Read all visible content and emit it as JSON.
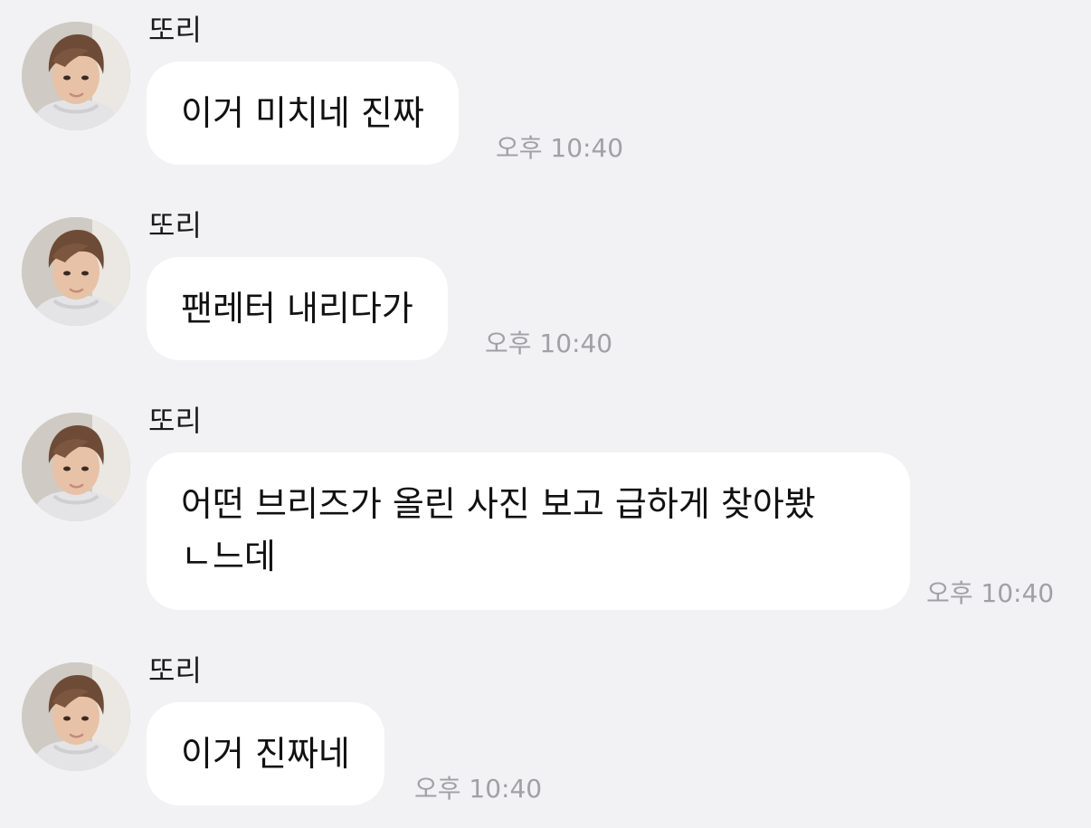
{
  "chat": {
    "messages": [
      {
        "sender": "또리",
        "avatar_icon": "profile-photo",
        "text": "이거 미치네 진짜",
        "time": "오후 10:40"
      },
      {
        "sender": "또리",
        "avatar_icon": "profile-photo",
        "text": "팬레터 내리다가",
        "time": "오후 10:40"
      },
      {
        "sender": "또리",
        "avatar_icon": "profile-photo",
        "text_lines": [
          "어떤 브리즈가 올린 사진 보고 급하게 찾아봤",
          "ㄴ느데"
        ],
        "time": "오후 10:40"
      },
      {
        "sender": "또리",
        "avatar_icon": "profile-photo",
        "text": "이거 진짜네",
        "time": "오후 10:40"
      }
    ]
  },
  "colors": {
    "background": "#f2f2f4",
    "bubble": "#ffffff",
    "timestamp": "#a0a0a6"
  }
}
